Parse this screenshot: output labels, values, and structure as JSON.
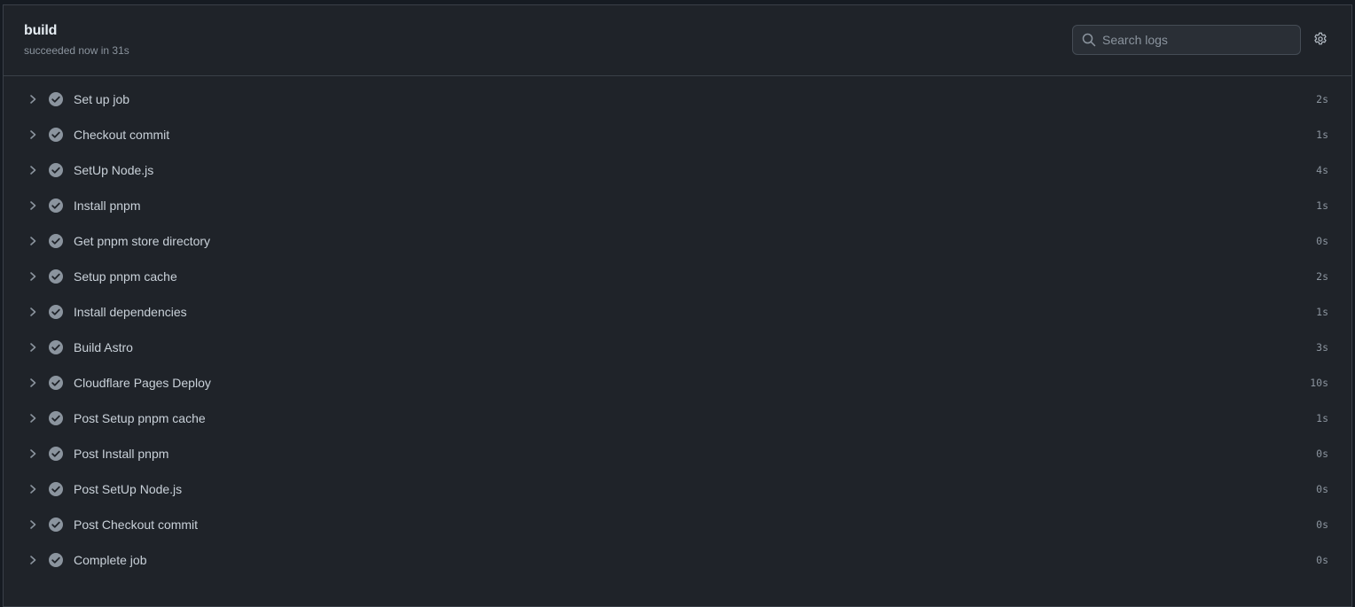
{
  "header": {
    "title": "build",
    "status": "succeeded now in 31s"
  },
  "search": {
    "placeholder": "Search logs",
    "value": "",
    "icon": "search-icon"
  },
  "settings": {
    "icon": "gear-icon"
  },
  "colors": {
    "panel_bg": "#1f2329",
    "border": "#3a4048",
    "check_fill": "#8b949e",
    "text_muted": "#8b949e"
  },
  "steps": [
    {
      "label": "Set up job",
      "duration": "2s",
      "status": "success"
    },
    {
      "label": "Checkout commit",
      "duration": "1s",
      "status": "success"
    },
    {
      "label": "SetUp Node.js",
      "duration": "4s",
      "status": "success"
    },
    {
      "label": "Install pnpm",
      "duration": "1s",
      "status": "success"
    },
    {
      "label": "Get pnpm store directory",
      "duration": "0s",
      "status": "success"
    },
    {
      "label": "Setup pnpm cache",
      "duration": "2s",
      "status": "success"
    },
    {
      "label": "Install dependencies",
      "duration": "1s",
      "status": "success"
    },
    {
      "label": "Build Astro",
      "duration": "3s",
      "status": "success"
    },
    {
      "label": "Cloudflare Pages Deploy",
      "duration": "10s",
      "status": "success"
    },
    {
      "label": "Post Setup pnpm cache",
      "duration": "1s",
      "status": "success"
    },
    {
      "label": "Post Install pnpm",
      "duration": "0s",
      "status": "success"
    },
    {
      "label": "Post SetUp Node.js",
      "duration": "0s",
      "status": "success"
    },
    {
      "label": "Post Checkout commit",
      "duration": "0s",
      "status": "success"
    },
    {
      "label": "Complete job",
      "duration": "0s",
      "status": "success"
    }
  ]
}
